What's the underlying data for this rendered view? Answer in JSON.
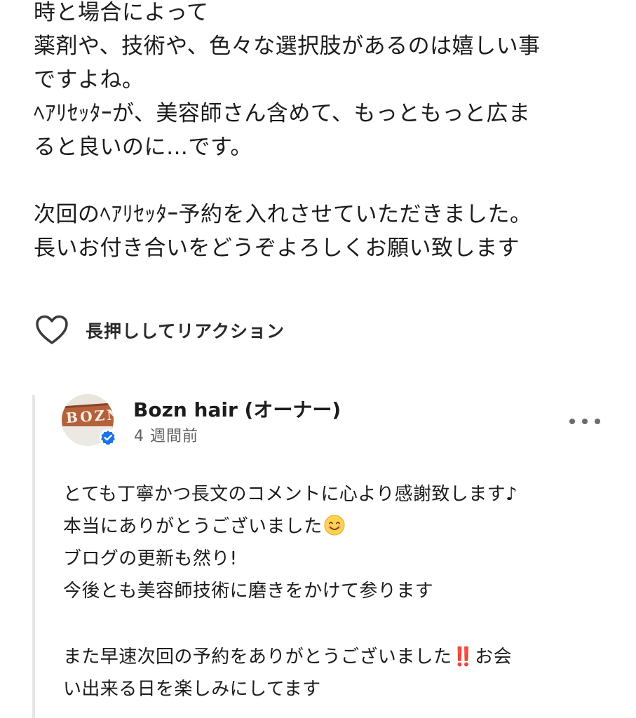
{
  "review": {
    "lines": [
      "時と場合によって",
      "薬剤や、技術や、色々な選択肢があるのは嬉しい事",
      "ですよね。",
      "ﾍｱﾘｾｯﾀｰが、美容師さん含めて、もっともっと広ま",
      "ると良いのに…です。",
      "次回のﾍｱﾘｾｯﾀｰ予約を入れさせていただきました。",
      "長いお付き合いをどうぞよろしくお願い致します"
    ]
  },
  "reaction": {
    "label": "長押ししてリアクション",
    "icon": "heart-outline-icon"
  },
  "reply": {
    "author": "Bozn hair (オーナー)",
    "time": "4 週間前",
    "verified_color": "#1a73e8",
    "avatar_text": "BOZN",
    "lines": [
      "とても丁寧かつ長文のコメントに心より感謝致します♪",
      "本当にありがとうございました",
      "ブログの更新も然り!",
      "今後とも美容師技術に磨きをかけて参ります",
      "また早速次回の予約をありがとうございました",
      "‼️",
      "お会",
      "い出来る日を楽しみにしてます"
    ],
    "smile_emoji": "smiling-face-emoji",
    "bang_color": "#e0242a"
  }
}
